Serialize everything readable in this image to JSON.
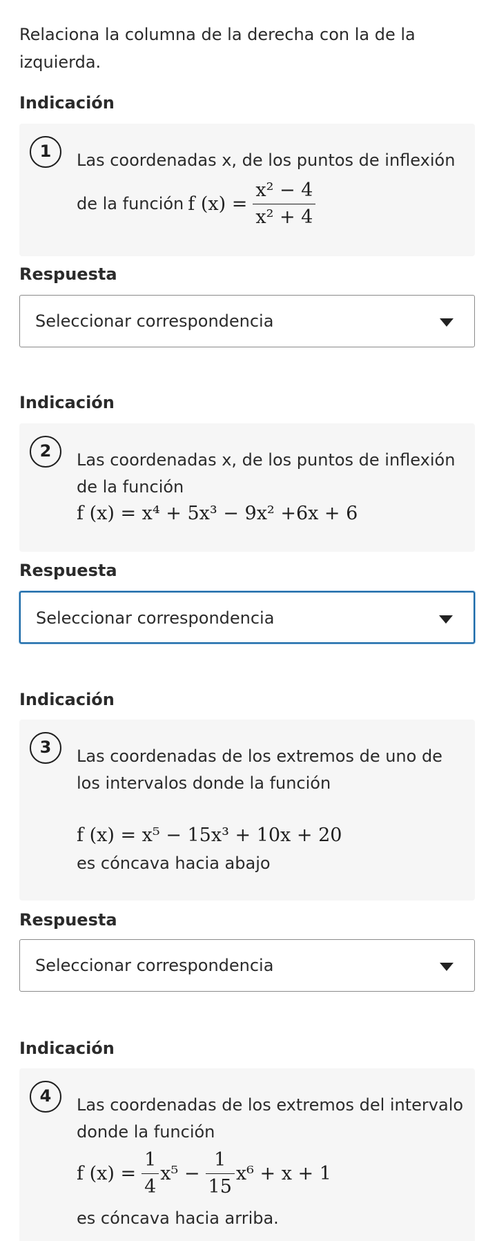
{
  "instructions": "Relaciona la columna de la derecha con la de la izquierda.",
  "items": [
    {
      "hint_label": "Indicación",
      "number": "1",
      "text_lines": [
        "Las coordenadas x, de los puntos de inflexión",
        "de la función"
      ],
      "formula_lhs": "f (x) =",
      "numerator": "x² − 4",
      "denominator": "x² + 4",
      "answer_label": "Respuesta",
      "select_value": "Seleccionar correspondencia"
    },
    {
      "hint_label": "Indicación",
      "number": "2",
      "text_lines": [
        "Las coordenadas x, de los puntos de inflexión",
        "de la función"
      ],
      "formula": "f (x) = x⁴ + 5x³ − 9x² +6x + 6",
      "answer_label": "Respuesta",
      "select_value": "Seleccionar correspondencia"
    },
    {
      "hint_label": "Indicación",
      "number": "3",
      "text_lines": [
        "Las coordenadas de los extremos de uno de",
        "los intervalos donde la función"
      ],
      "formula": "f (x) = x⁵ − 15x³ + 10x + 20",
      "after_text": "es cóncava hacia abajo",
      "answer_label": "Respuesta",
      "select_value": "Seleccionar correspondencia"
    },
    {
      "hint_label": "Indicación",
      "number": "4",
      "text_lines": [
        "Las coordenadas de los extremos del intervalo",
        "donde la función"
      ],
      "formula_lhs": "f (x) =",
      "frac1_num": "1",
      "frac1_den": "4",
      "mid_term": "x⁵ −",
      "frac2_num": "1",
      "frac2_den": "15",
      "tail_term": "x⁶ + x + 1",
      "after_text": "es cóncava hacia arriba."
    }
  ]
}
